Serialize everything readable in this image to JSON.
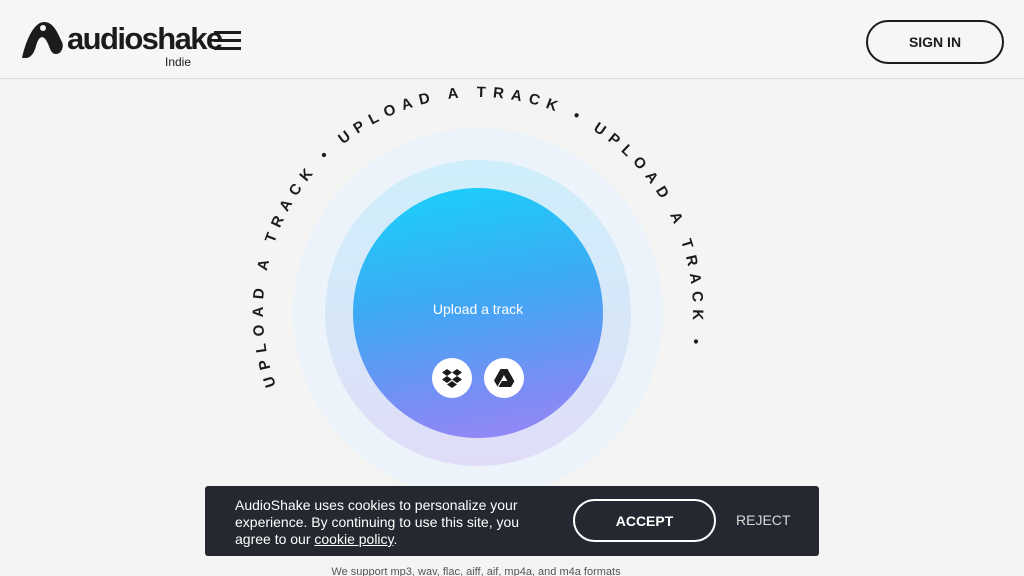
{
  "header": {
    "logo_word": "audioshake",
    "logo_sub": "Indie",
    "sign_in_label": "SIGN IN",
    "menu_icon": "hamburger-menu-icon"
  },
  "upload": {
    "ring_text": "UPLOAD A TRACK • UPLOAD A TRACK • UPLOAD A TRACK • ",
    "center_label": "Upload a track",
    "sources": [
      {
        "name": "dropbox",
        "icon": "dropbox-icon"
      },
      {
        "name": "google-drive",
        "icon": "google-drive-icon"
      }
    ],
    "formats_note": "We support mp3, wav, flac, aiff, aif, mp4a, and m4a formats"
  },
  "cookie_banner": {
    "text": "AudioShake uses cookies to personalize your experience. By continuing to use this site, you agree to our ",
    "link_label": "cookie policy",
    "text_end": ".",
    "accept_label": "ACCEPT",
    "reject_label": "REJECT"
  },
  "colors": {
    "circle_top": "#18d2fb",
    "circle_bottom": "#9b86f6",
    "banner_bg": "#252830"
  }
}
